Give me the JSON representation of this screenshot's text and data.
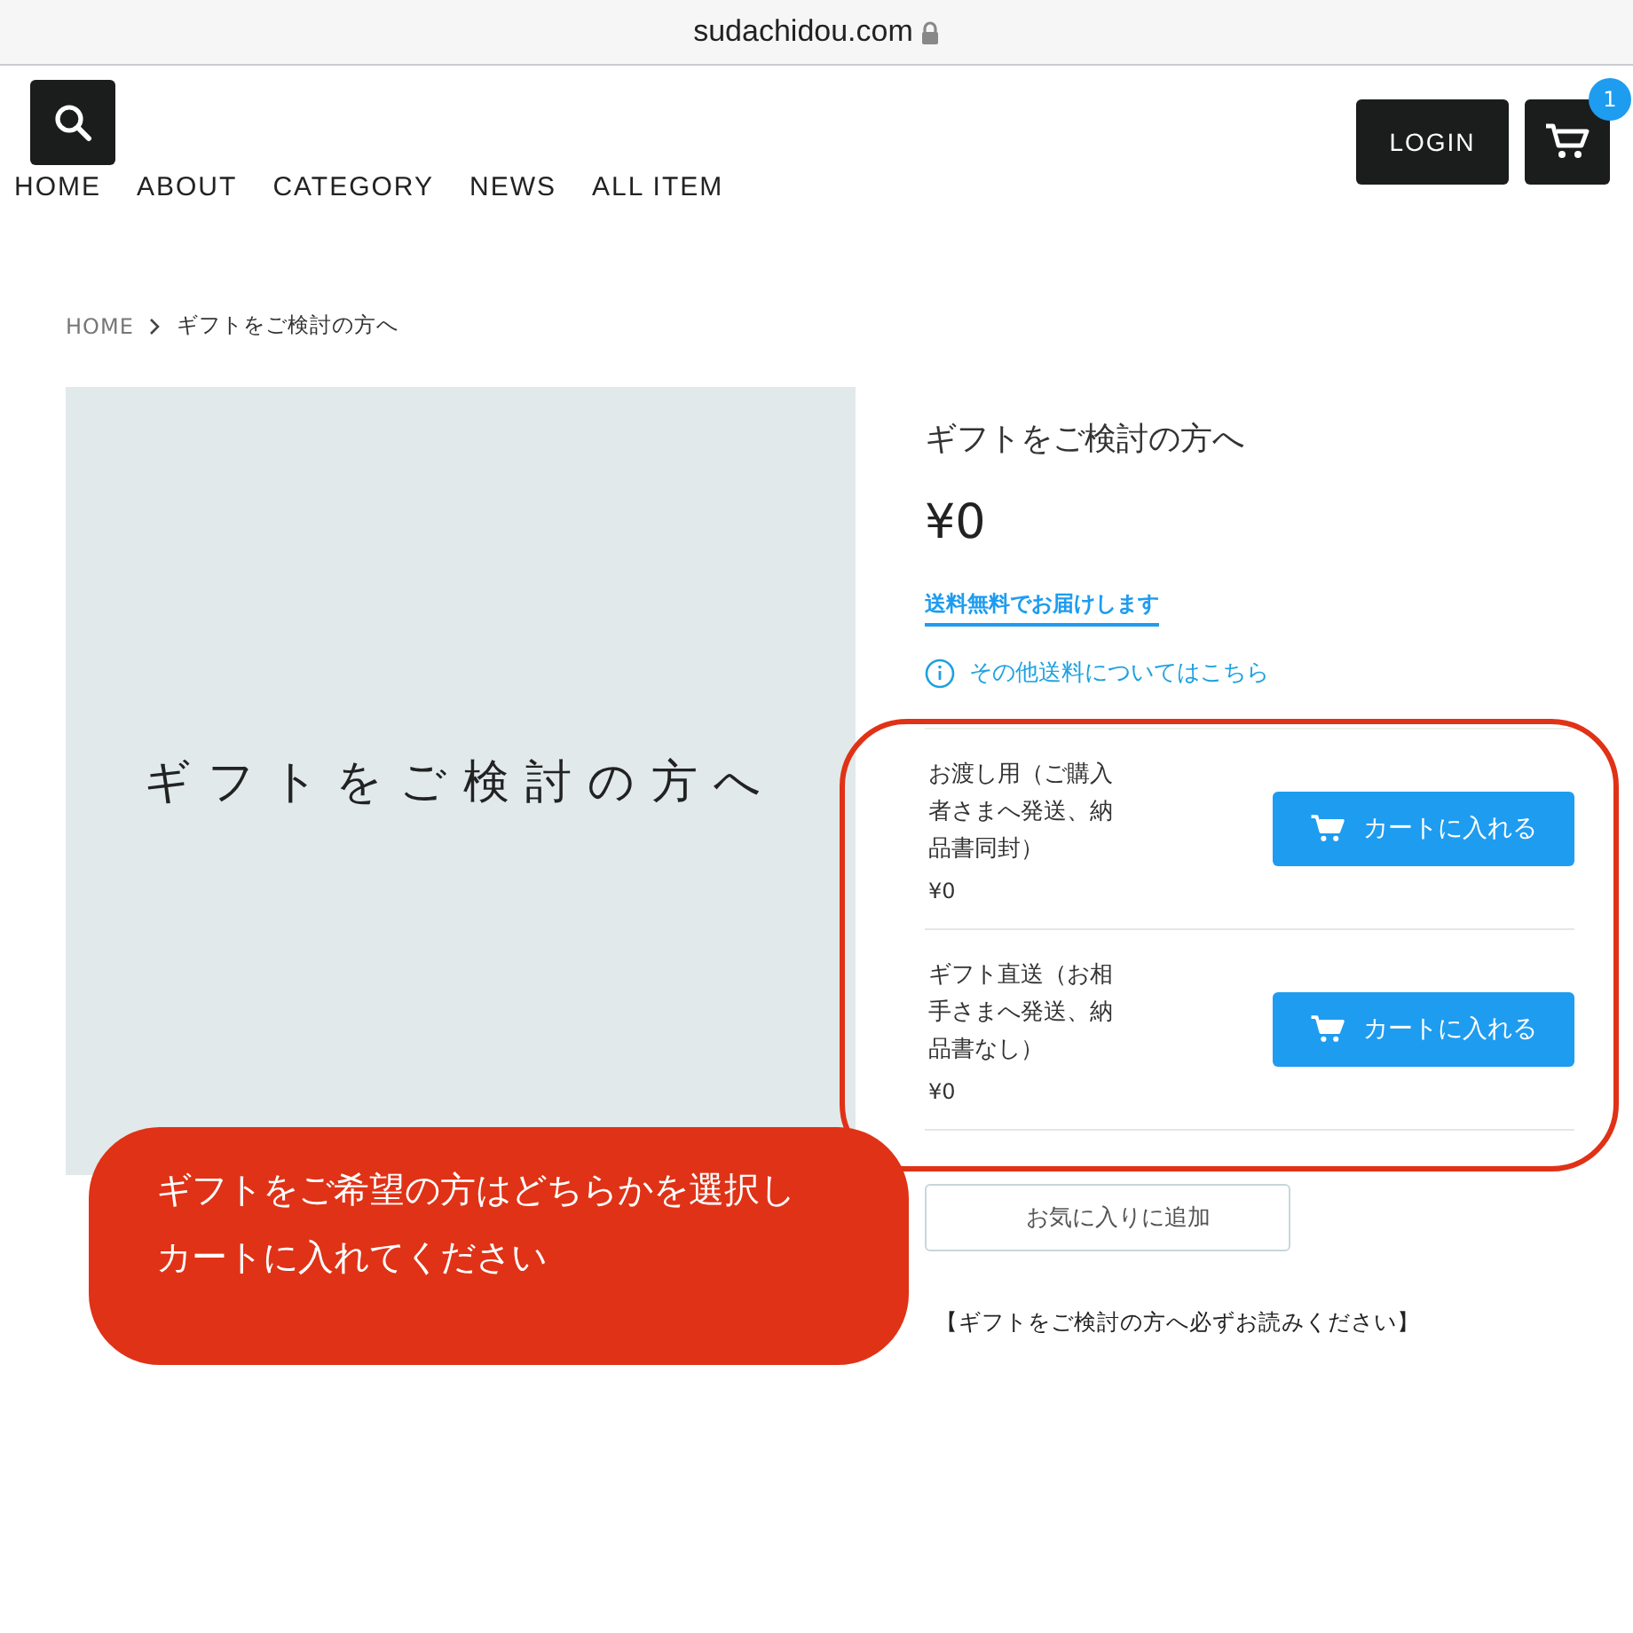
{
  "browser": {
    "url": "sudachidou.com"
  },
  "header": {
    "nav": [
      "HOME",
      "ABOUT",
      "CATEGORY",
      "NEWS",
      "ALL ITEM"
    ],
    "login": "LOGIN",
    "cart_count": "1"
  },
  "breadcrumb": [
    "HOME",
    "ギフトをご検討の方へ"
  ],
  "product": {
    "image_caption": "ギフトをご検討の方へ",
    "title": "ギフトをご検討の方へ",
    "price": "¥0",
    "shipping": "**送料無料**でお届けします",
    "shipping_link": "その他送料についてはこちら",
    "options": [
      {
        "name": "お渡し用（ご購入者さまへ発送、納品書同封）",
        "price": "¥0",
        "button": "カートに入れる"
      },
      {
        "name": "ギフト直送（お相手さまへ発送、納品書なし）",
        "price": "¥0",
        "button": "カートに入れる"
      }
    ],
    "favorite": "お気に入りに追加",
    "note": "【ギフトをご検討の方へ必ずお読みください】"
  },
  "annotation": {
    "lines": [
      "ギフトをご希望の方はどちらかを選択し",
      "カートに入れてください"
    ]
  }
}
